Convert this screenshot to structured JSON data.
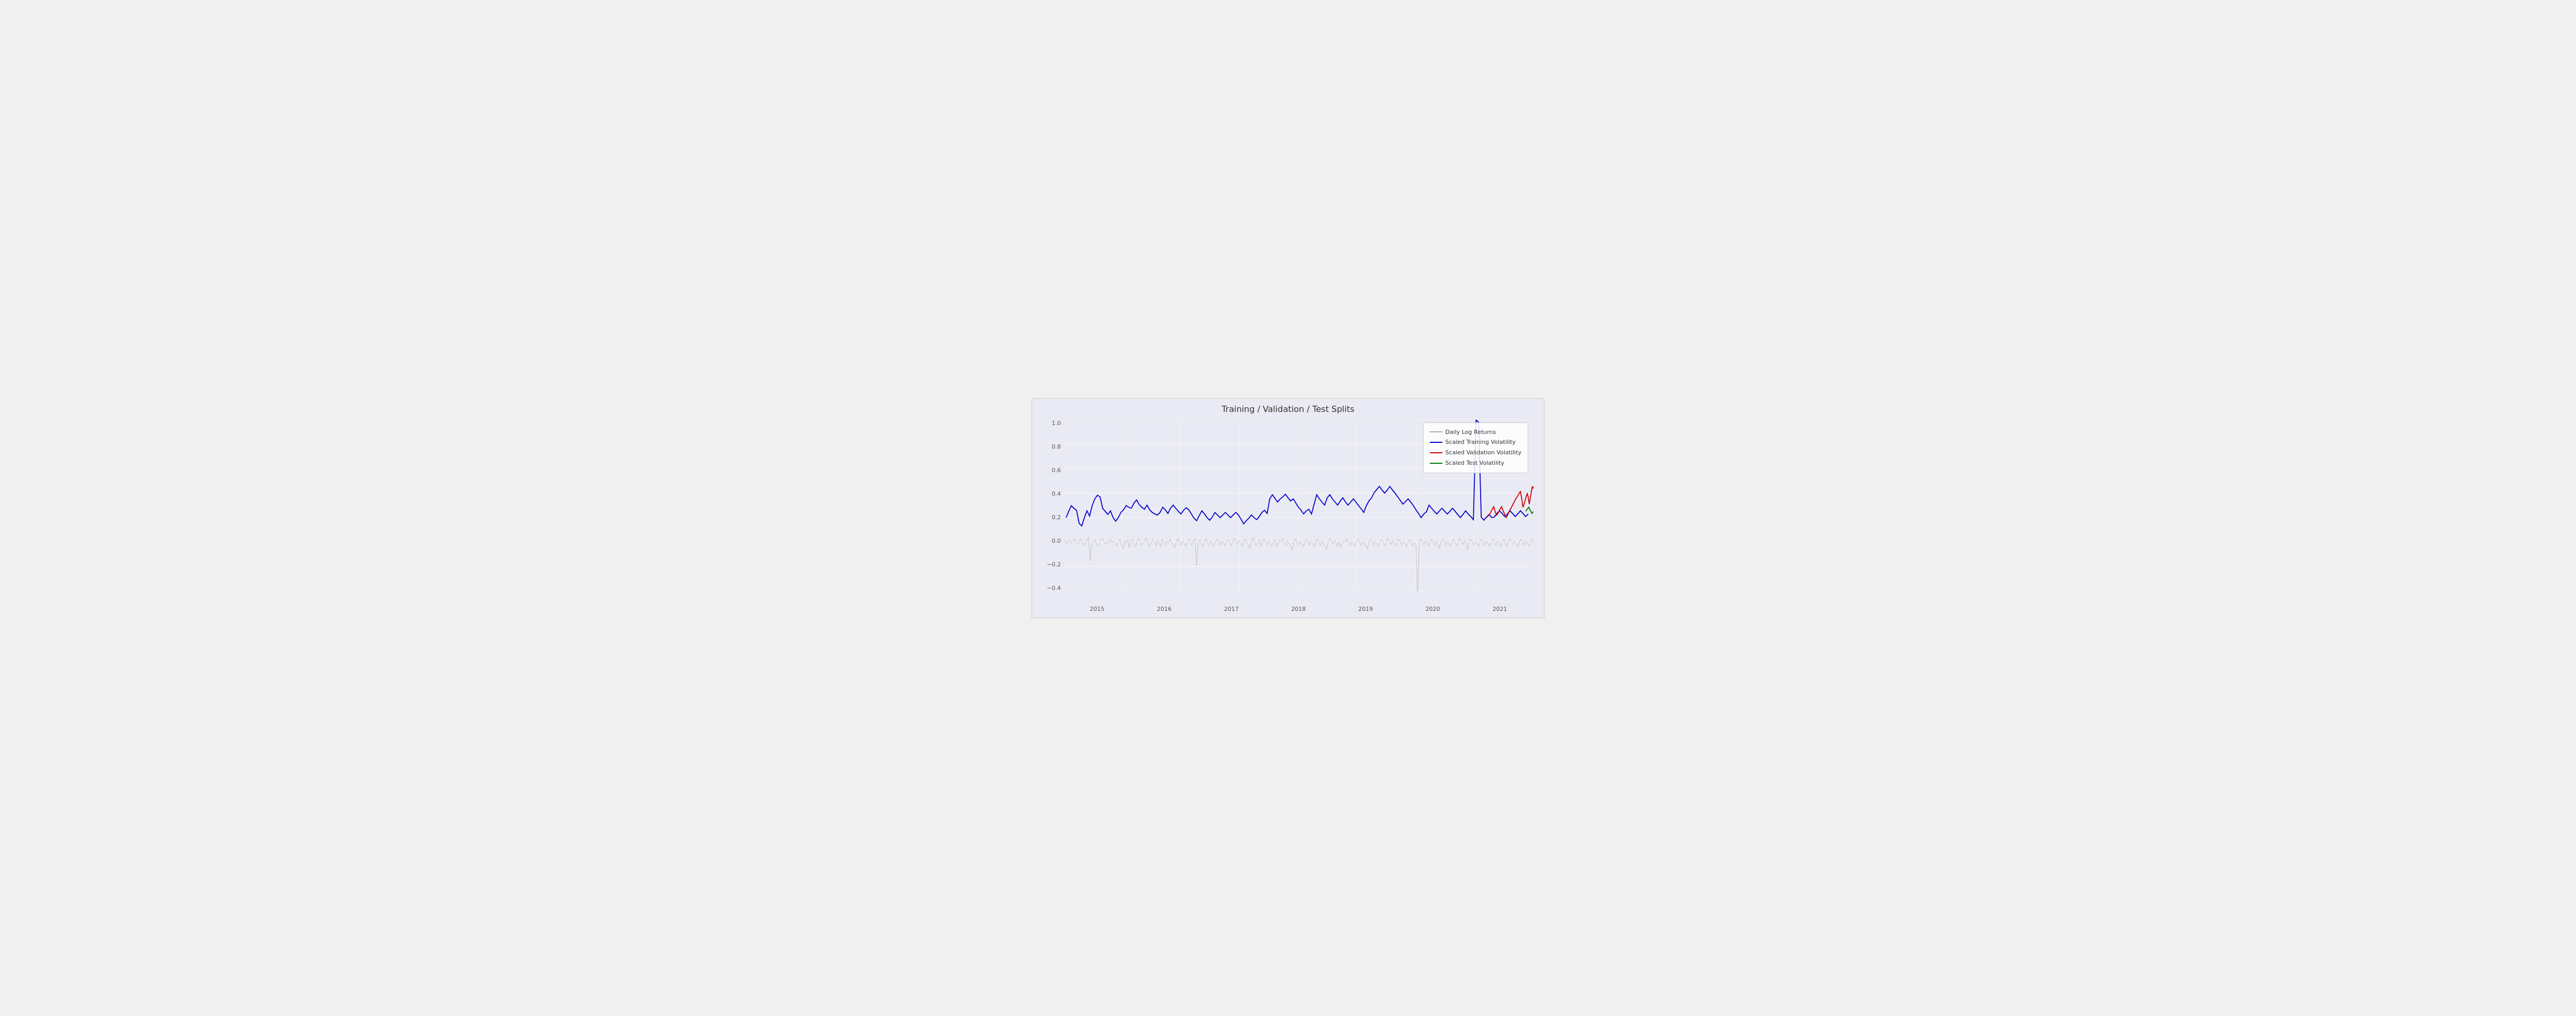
{
  "chart": {
    "title": "Training / Validation / Test Splits",
    "y_axis": {
      "labels": [
        "1.0",
        "0.8",
        "0.6",
        "0.4",
        "0.2",
        "0.0",
        "-0.2",
        "-0.4"
      ]
    },
    "x_axis": {
      "labels": [
        "2015",
        "2016",
        "2017",
        "2018",
        "2019",
        "2020",
        "2021"
      ]
    },
    "legend": {
      "items": [
        {
          "label": "Daily Log Returns",
          "color": "#aaaaaa",
          "type": "line"
        },
        {
          "label": "Scaled Training Volatility",
          "color": "#0000cc",
          "type": "line"
        },
        {
          "label": "Scaled Validation Volatility",
          "color": "#cc0000",
          "type": "line"
        },
        {
          "label": "Scaled Test Volatility",
          "color": "#007700",
          "type": "line"
        }
      ]
    }
  }
}
